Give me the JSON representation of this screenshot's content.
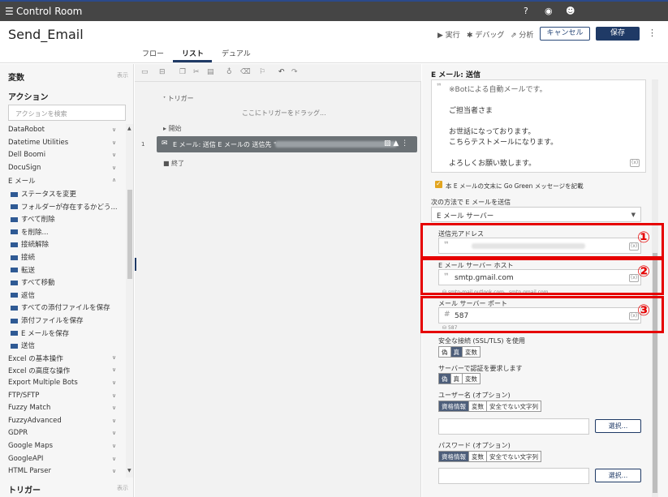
{
  "topbar": {
    "menu_icon": "☰",
    "app_title": "Control Room"
  },
  "header": {
    "page_title": "Send_Email",
    "run_label": "▶ 実行",
    "debug_label": "✱ デバッグ",
    "analyze_label": "⇗ 分析",
    "cancel_label": "キャンセル",
    "save_label": "保存",
    "more_icon": "⋮",
    "tabs": [
      "フロー",
      "リスト",
      "デュアル"
    ]
  },
  "left": {
    "variables_label": "変数",
    "variables_hint": "表示",
    "actions_label": "アクション",
    "search_placeholder": "アクションを検索",
    "actions": [
      {
        "label": "DataRobot",
        "sub": false
      },
      {
        "label": "Datetime Utilities",
        "sub": false
      },
      {
        "label": "Dell Boomi",
        "sub": false
      },
      {
        "label": "DocuSign",
        "sub": false
      },
      {
        "label": "E メール",
        "sub": false
      },
      {
        "label": "ステータスを変更",
        "sub": true
      },
      {
        "label": "フォルダーが存在するかどう...",
        "sub": true
      },
      {
        "label": "すべて削除",
        "sub": true
      },
      {
        "label": "を削除...",
        "sub": true
      },
      {
        "label": "接続解除",
        "sub": true
      },
      {
        "label": "接続",
        "sub": true
      },
      {
        "label": "転送",
        "sub": true
      },
      {
        "label": "すべて移動",
        "sub": true
      },
      {
        "label": "返信",
        "sub": true
      },
      {
        "label": "すべての添付ファイルを保存",
        "sub": true
      },
      {
        "label": "添付ファイルを保存",
        "sub": true
      },
      {
        "label": "E メールを保存",
        "sub": true
      },
      {
        "label": "送信",
        "sub": true
      },
      {
        "label": "Excel の基本操作",
        "sub": false
      },
      {
        "label": "Excel の高度な操作",
        "sub": false
      },
      {
        "label": "Export Multiple Bots",
        "sub": false
      },
      {
        "label": "FTP/SFTP",
        "sub": false
      },
      {
        "label": "Fuzzy Match",
        "sub": false
      },
      {
        "label": "FuzzyAdvanced",
        "sub": false
      },
      {
        "label": "GDPR",
        "sub": false
      },
      {
        "label": "Google Maps",
        "sub": false
      },
      {
        "label": "GoogleAPI",
        "sub": false
      },
      {
        "label": "HTML Parser",
        "sub": false
      }
    ],
    "triggers_label": "トリガー",
    "triggers_hint": "表示"
  },
  "middle": {
    "trigger_label": "トリガー",
    "trigger_drop": "ここにトリガーをドラッグ...",
    "start_label": "開始",
    "step_number": "1",
    "step_label": "E メール: 送信 E メールの 送信先 \"",
    "end_label": "終了"
  },
  "right": {
    "title": "E メール: 送信",
    "message_lines": [
      "※Botによる自動メールです。",
      "ご担当者さま",
      "お世話になっております。",
      "こちらテストメールになります。",
      "よろしくお願い致します。"
    ],
    "checkbox_label": "本 E メールの文末に Go Green メッセージを記載",
    "send_method_label": "次の方法で E メールを送信",
    "send_method_value": "E メール サーバー",
    "from_label": "送信元アドレス",
    "from_value": "",
    "host_label": "E メール サーバー ホスト",
    "host_value": "smtp.gmail.com",
    "host_hint": "smtp-mail.outlook.com、smtp.gmail.com",
    "port_label": "メール サーバー ポート",
    "port_value": "587",
    "port_hint": "587",
    "ssl_label": "安全な接続 (SSL/TLS) を使用",
    "ssl_options": [
      "偽",
      "真",
      "変数"
    ],
    "auth_label": "サーバーで認証を要求します",
    "auth_options": [
      "偽",
      "真",
      "変数"
    ],
    "user_label": "ユーザー名 (オプション)",
    "user_options": [
      "資格情報",
      "変数",
      "安全でない文字列"
    ],
    "select_label": "選択...",
    "pass_label": "パスワード (オプション)",
    "pass_options": [
      "資格情報",
      "変数",
      "安全でない文字列"
    ],
    "select_label2": "選択...",
    "annotations": [
      "①",
      "②",
      "③"
    ]
  }
}
